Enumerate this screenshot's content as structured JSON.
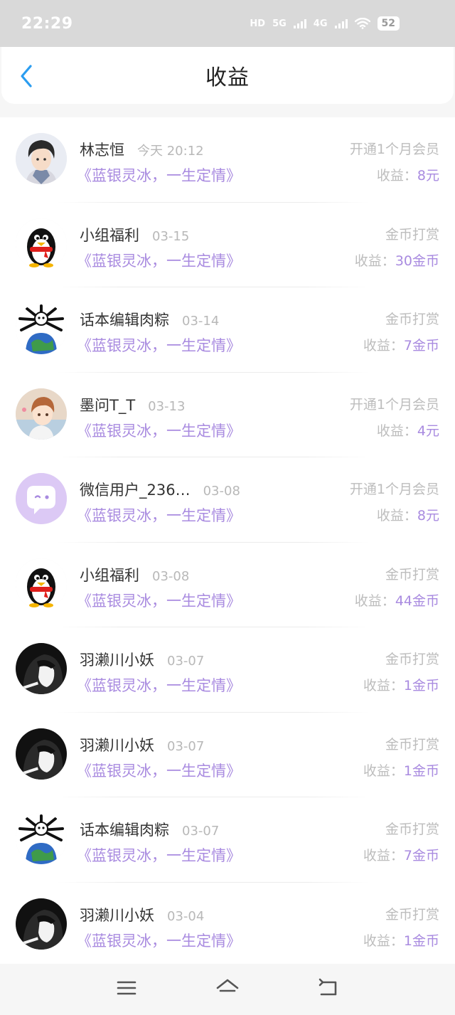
{
  "status_bar": {
    "time": "22:29",
    "hd_label": "HD",
    "net1": "5G",
    "net2": "4G",
    "battery": "52"
  },
  "header": {
    "title": "收益",
    "back_icon": "chevron-left-icon",
    "accent_color": "#2b9df0"
  },
  "earnings": [
    {
      "name": "林志恒",
      "date": "今天 20:12",
      "novel": "《蓝银灵冰，一生定情》",
      "type": "开通1个月会员",
      "earn_label": "收益：",
      "earn_value": "8元",
      "avatar": "boy-avatar"
    },
    {
      "name": "小组福利",
      "date": "03-15",
      "novel": "《蓝银灵冰，一生定情》",
      "type": "金币打赏",
      "earn_label": "收益：",
      "earn_value": "30金币",
      "avatar": "penguin-avatar"
    },
    {
      "name": "话本编辑肉粽",
      "date": "03-14",
      "novel": "《蓝银灵冰，一生定情》",
      "type": "金币打赏",
      "earn_label": "收益：",
      "earn_value": "7金币",
      "avatar": "globe-bones-avatar"
    },
    {
      "name": "墨问T_T",
      "date": "03-13",
      "novel": "《蓝银灵冰，一生定情》",
      "type": "开通1个月会员",
      "earn_label": "收益：",
      "earn_value": "4元",
      "avatar": "anime-boy-avatar"
    },
    {
      "name": "微信用户_236…",
      "date": "03-08",
      "novel": "《蓝银灵冰，一生定情》",
      "type": "开通1个月会员",
      "earn_label": "收益：",
      "earn_value": "8元",
      "avatar": "chat-bubble-avatar"
    },
    {
      "name": "小组福利",
      "date": "03-08",
      "novel": "《蓝银灵冰，一生定情》",
      "type": "金币打赏",
      "earn_label": "收益：",
      "earn_value": "44金币",
      "avatar": "penguin-avatar"
    },
    {
      "name": "羽濑川小妖",
      "date": "03-07",
      "novel": "《蓝银灵冰，一生定情》",
      "type": "金币打赏",
      "earn_label": "收益：",
      "earn_value": "1金币",
      "avatar": "dark-hood-avatar"
    },
    {
      "name": "羽濑川小妖",
      "date": "03-07",
      "novel": "《蓝银灵冰，一生定情》",
      "type": "金币打赏",
      "earn_label": "收益：",
      "earn_value": "1金币",
      "avatar": "dark-hood-avatar"
    },
    {
      "name": "话本编辑肉粽",
      "date": "03-07",
      "novel": "《蓝银灵冰，一生定情》",
      "type": "金币打赏",
      "earn_label": "收益：",
      "earn_value": "7金币",
      "avatar": "globe-bones-avatar"
    },
    {
      "name": "羽濑川小妖",
      "date": "03-04",
      "novel": "《蓝银灵冰，一生定情》",
      "type": "金币打赏",
      "earn_label": "收益：",
      "earn_value": "1金币",
      "avatar": "dark-hood-avatar"
    }
  ],
  "nav": {
    "menu_icon": "menu-icon",
    "home_icon": "home-icon",
    "back_icon": "back-arrow-icon"
  }
}
